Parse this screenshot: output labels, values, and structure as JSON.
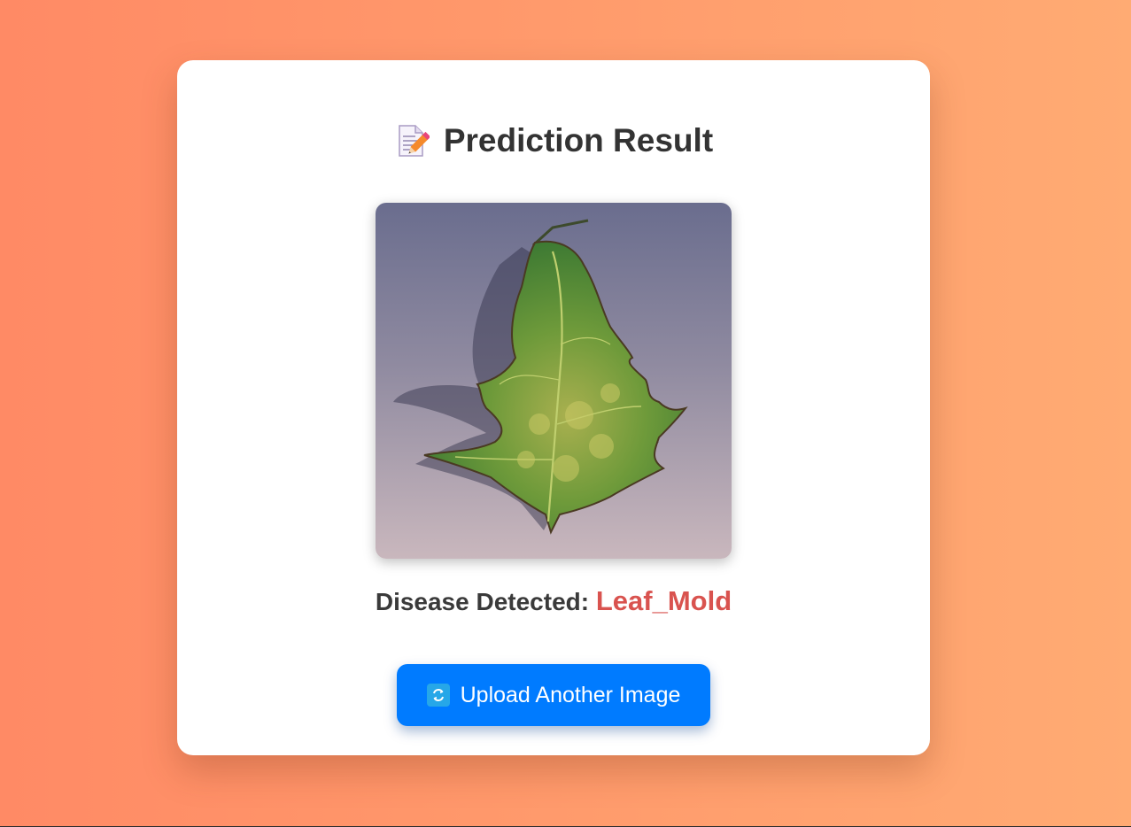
{
  "result_card": {
    "title": "Prediction Result",
    "title_icon": "memo-icon",
    "image_alt": "uploaded tomato leaf",
    "disease_label": "Disease Detected:",
    "disease_value": "Leaf_Mold",
    "upload_button_label": "Upload Another Image",
    "upload_button_icon": "refresh-icon"
  },
  "colors": {
    "background_start": "#ff8a65",
    "background_end": "#ffab73",
    "card": "#ffffff",
    "disease_value": "#d9534f",
    "button": "#007bff"
  }
}
